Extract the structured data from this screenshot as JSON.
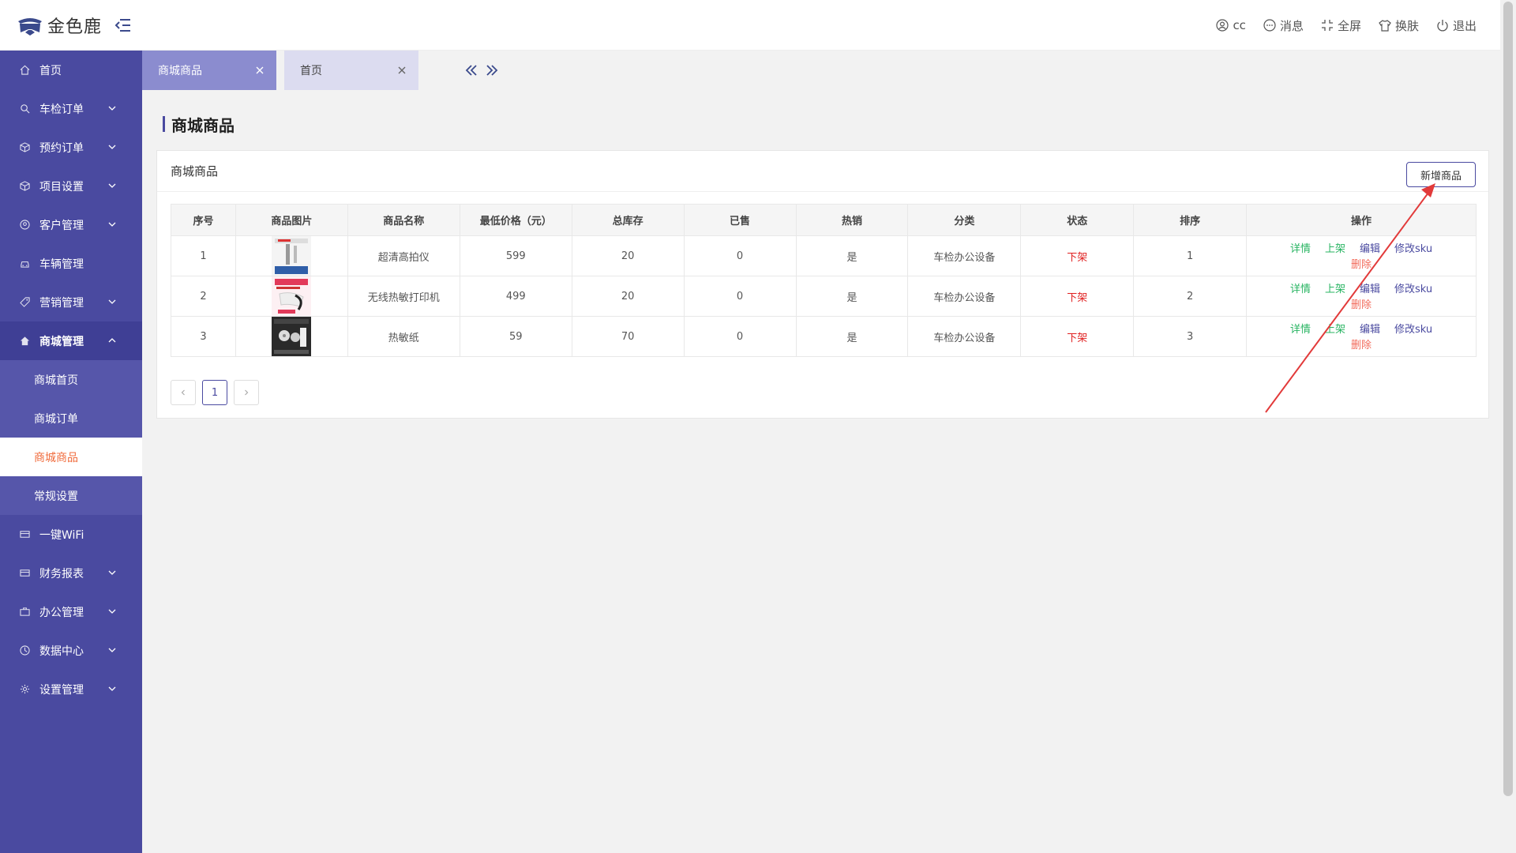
{
  "header": {
    "brand": "金色鹿",
    "user": "cc",
    "messages": "消息",
    "fullscreen": "全屏",
    "skin": "换肤",
    "logout": "退出"
  },
  "sidebar": {
    "items": [
      {
        "label": "首页",
        "icon": "home-icon"
      },
      {
        "label": "车检订单",
        "icon": "search-icon"
      },
      {
        "label": "预约订单",
        "icon": "cube-icon"
      },
      {
        "label": "项目设置",
        "icon": "cube-icon"
      },
      {
        "label": "客户管理",
        "icon": "user-icon"
      },
      {
        "label": "车辆管理",
        "icon": "car-icon"
      },
      {
        "label": "营销管理",
        "icon": "tag-icon"
      },
      {
        "label": "商城管理",
        "icon": "home-icon"
      },
      {
        "label": "一键WiFi",
        "icon": "list-icon"
      },
      {
        "label": "财务报表",
        "icon": "list-icon"
      },
      {
        "label": "办公管理",
        "icon": "briefcase-icon"
      },
      {
        "label": "数据中心",
        "icon": "clock-icon"
      },
      {
        "label": "设置管理",
        "icon": "gear-icon"
      }
    ],
    "submenu": [
      "商城首页",
      "商城订单",
      "商城商品",
      "常规设置"
    ]
  },
  "tabs": [
    {
      "label": "商城商品"
    },
    {
      "label": "首页"
    }
  ],
  "page": {
    "title": "商城商品",
    "card_title": "商城商品",
    "add_button": "新增商品"
  },
  "table": {
    "columns": [
      "序号",
      "商品图片",
      "商品名称",
      "最低价格（元）",
      "总库存",
      "已售",
      "热销",
      "分类",
      "状态",
      "排序",
      "操作"
    ],
    "rows": [
      {
        "no": "1",
        "name": "超清高拍仪",
        "price": "599",
        "stock": "20",
        "sold": "0",
        "hot": "是",
        "category": "车检办公设备",
        "status": "下架",
        "sort": "1"
      },
      {
        "no": "2",
        "name": "无线热敏打印机",
        "price": "499",
        "stock": "20",
        "sold": "0",
        "hot": "是",
        "category": "车检办公设备",
        "status": "下架",
        "sort": "2"
      },
      {
        "no": "3",
        "name": "热敏纸",
        "price": "59",
        "stock": "70",
        "sold": "0",
        "hot": "是",
        "category": "车检办公设备",
        "status": "下架",
        "sort": "3"
      }
    ],
    "ops": {
      "detail": "详情",
      "on": "上架",
      "edit": "编辑",
      "sku": "修改sku",
      "del": "删除"
    }
  },
  "pager": {
    "current": "1"
  },
  "colors": {
    "primary": "#4a4aa0",
    "accent": "#f06b3c",
    "danger": "#e02020",
    "success": "#28b462"
  }
}
